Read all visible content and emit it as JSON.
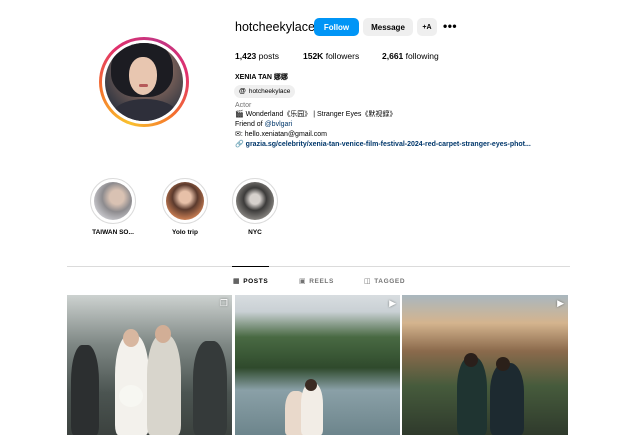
{
  "profile": {
    "username": "hotcheekylace",
    "follow_label": "Follow",
    "message_label": "Message",
    "add_user_label": "+A",
    "more_label": "•••",
    "posts_count": "1,423",
    "posts_label": "posts",
    "followers_count": "152K",
    "followers_label": "followers",
    "following_count": "2,661",
    "following_label": "following",
    "full_name": "XENIA TAN 娜娜",
    "threads_handle": "hotcheekylace",
    "category": "Actor",
    "bio_line1": "🎬 Wonderland《乐园》 | Stranger Eyes《默视録》",
    "bio_line2_prefix": "Friend of ",
    "bio_line2_mention": "@bvlgari",
    "bio_line3": "✉︎: hello.xeniatan@gmail.com",
    "link": "grazia.sg/celebrity/xenia-tan-venice-film-festival-2024-red-carpet-stranger-eyes-phot..."
  },
  "highlights": [
    {
      "label": "TAIWAN SO..."
    },
    {
      "label": "Yolo trip"
    },
    {
      "label": "NYC"
    }
  ],
  "tabs": [
    {
      "label": "POSTS",
      "icon": "grid-icon",
      "active": true
    },
    {
      "label": "REELS",
      "icon": "reels-icon",
      "active": false
    },
    {
      "label": "TAGGED",
      "icon": "tagged-icon",
      "active": false
    }
  ],
  "posts": [
    {
      "type": "carousel",
      "icon": "carousel-icon"
    },
    {
      "type": "reel",
      "icon": "reel-icon"
    },
    {
      "type": "reel",
      "icon": "reel-icon"
    }
  ],
  "colors": {
    "follow_button": "#0095f6",
    "secondary_button": "#efefef",
    "link": "#00376b",
    "muted_text": "#737373"
  }
}
